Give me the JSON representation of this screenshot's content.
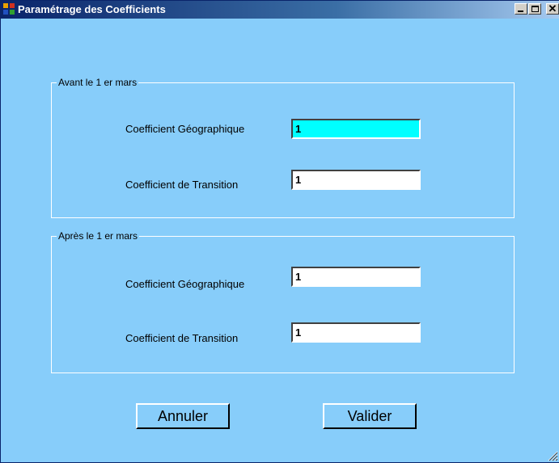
{
  "window": {
    "title": "Paramétrage des Coefficients",
    "controls": {
      "minimize": "_",
      "maximize": "□",
      "close": "✕"
    }
  },
  "groups": [
    {
      "legend": "Avant le 1 er mars",
      "fields": [
        {
          "label": "Coefficient Géographique",
          "value": "1",
          "focused": true
        },
        {
          "label": "Coefficient de Transition",
          "value": "1"
        }
      ]
    },
    {
      "legend": "Après le 1 er mars",
      "fields": [
        {
          "label": "Coefficient Géographique",
          "value": "1"
        },
        {
          "label": "Coefficient de Transition",
          "value": "1"
        }
      ]
    }
  ],
  "buttons": {
    "cancel": "Annuler",
    "validate": "Valider"
  },
  "colors": {
    "background": "#87cdfa",
    "focused_field": "#00ffff",
    "title_bar": "#0a246a"
  }
}
